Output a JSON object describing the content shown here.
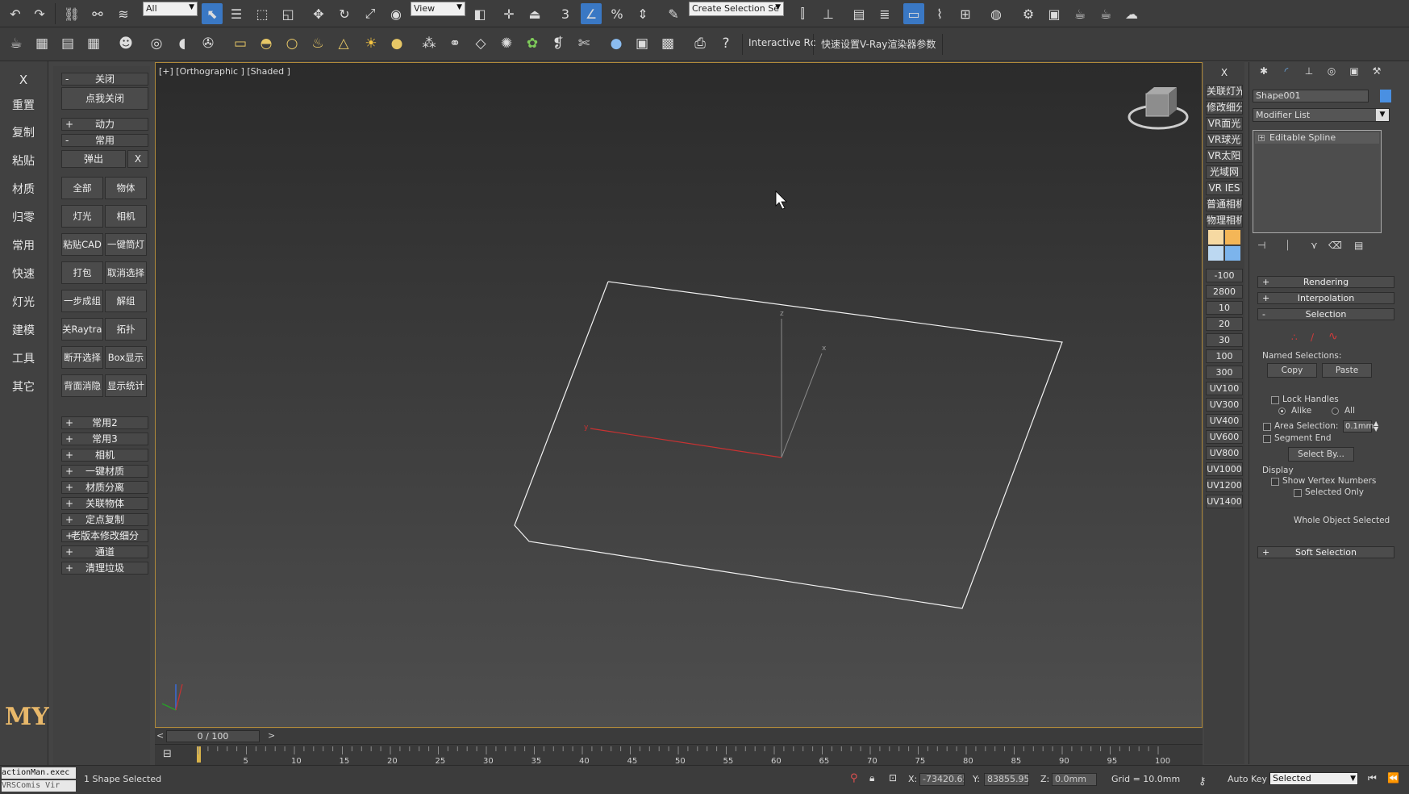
{
  "toolbar_main": {
    "selection_filter": "All",
    "reference_coord": "View",
    "named_selection_set": "Create Selection Se",
    "snaps": {
      "snap_number": "3",
      "angle_snap": "",
      "percent_snap": "%"
    }
  },
  "toolbar_secondary": {
    "interactive_label": "Interactive Rc",
    "vray_quick_label": "快速设置V-Ray渲染器参数"
  },
  "left_column": {
    "close_x": "X",
    "items": [
      "重置",
      "复制",
      "粘贴",
      "材质",
      "归零",
      "常用",
      "快速",
      "灯光",
      "建模",
      "工具",
      "其它"
    ],
    "logo": "MY"
  },
  "left_panel": {
    "close_rollout": {
      "sign": "-",
      "label": "关闭"
    },
    "click_close": "点我关闭",
    "dynamics_rollout": {
      "sign": "+",
      "label": "动力"
    },
    "common_rollout": {
      "sign": "-",
      "label": "常用"
    },
    "popup": "弹出",
    "popup_x": "X",
    "buttons": [
      [
        "全部",
        "物体"
      ],
      [
        "灯光",
        "相机"
      ],
      [
        "粘贴CAD",
        "一键筒灯"
      ],
      [
        "打包",
        "取消选择"
      ],
      [
        "一步成组",
        "解组"
      ],
      [
        "关Raytrace",
        "拓扑"
      ],
      [
        "断开选择",
        "Box显示"
      ],
      [
        "背面消隐",
        "显示统计"
      ]
    ],
    "rollouts": [
      {
        "sign": "+",
        "label": "常用2"
      },
      {
        "sign": "+",
        "label": "常用3"
      },
      {
        "sign": "+",
        "label": "相机"
      },
      {
        "sign": "+",
        "label": "一键材质"
      },
      {
        "sign": "+",
        "label": "材质分离"
      },
      {
        "sign": "+",
        "label": "关联物体"
      },
      {
        "sign": "+",
        "label": "定点复制"
      },
      {
        "sign": "+",
        "label": "老版本修改细分"
      },
      {
        "sign": "+",
        "label": "通道"
      },
      {
        "sign": "+",
        "label": "清理垃圾"
      }
    ]
  },
  "viewport": {
    "label": "[+] [Orthographic ] [Shaded ]",
    "axis_labels": {
      "x": "x",
      "y": "y",
      "z": "z"
    }
  },
  "right_column": {
    "close": "X",
    "items": [
      "关联灯光",
      "修改细分",
      "VR面光",
      "VR球光",
      "VR太阳",
      "光域网",
      "VR IES",
      "普通相机",
      "物理相机"
    ],
    "swatches": [
      "#f6d9a2",
      "#f4b657",
      "#bcd8f1",
      "#7cb4ec"
    ],
    "values": [
      "-100",
      "2800",
      "10",
      "20",
      "30",
      "100",
      "300",
      "UV100",
      "UV300",
      "UV400",
      "UV600",
      "UV800",
      "UV1000",
      "UV1200",
      "UV1400"
    ]
  },
  "command_panel": {
    "object_name": "Shape001",
    "object_color": "#4a90e2",
    "modifier_list": "Modifier List",
    "stack_item": "Editable Spline",
    "rollouts": {
      "rendering": {
        "sign": "+",
        "label": "Rendering"
      },
      "interpolation": {
        "sign": "+",
        "label": "Interpolation"
      },
      "selection": {
        "sign": "-",
        "label": "Selection"
      },
      "soft_selection": {
        "sign": "+",
        "label": "Soft Selection"
      }
    },
    "named_selections": "Named Selections:",
    "copy": "Copy",
    "paste": "Paste",
    "lock_handles": "Lock Handles",
    "alike": "Alike",
    "all": "All",
    "area_selection": "Area Selection:",
    "area_value": "0.1mm",
    "segment_end": "Segment End",
    "select_by": "Select By...",
    "display": "Display",
    "show_vertex_numbers": "Show Vertex Numbers",
    "selected_only": "Selected Only",
    "whole_object_selected": "Whole Object Selected"
  },
  "timeline": {
    "frame_display": "0 / 100",
    "prev": "<",
    "next": ">",
    "ticks": [
      "5",
      "10",
      "15",
      "20",
      "25",
      "30",
      "35",
      "40",
      "45",
      "50",
      "55",
      "60",
      "65",
      "70",
      "75",
      "80",
      "85",
      "90",
      "95",
      "100"
    ]
  },
  "status": {
    "script_line1": "actionMan.exec",
    "script_line2": "VRSComis Vir",
    "selection_text": "1 Shape Selected",
    "x_label": "X:",
    "x_value": "-73420.656",
    "y_label": "Y:",
    "y_value": "83855.953",
    "z_label": "Z:",
    "z_value": "0.0mm",
    "grid": "Grid = 10.0mm",
    "auto_key": "Auto Key",
    "selected": "Selected"
  }
}
